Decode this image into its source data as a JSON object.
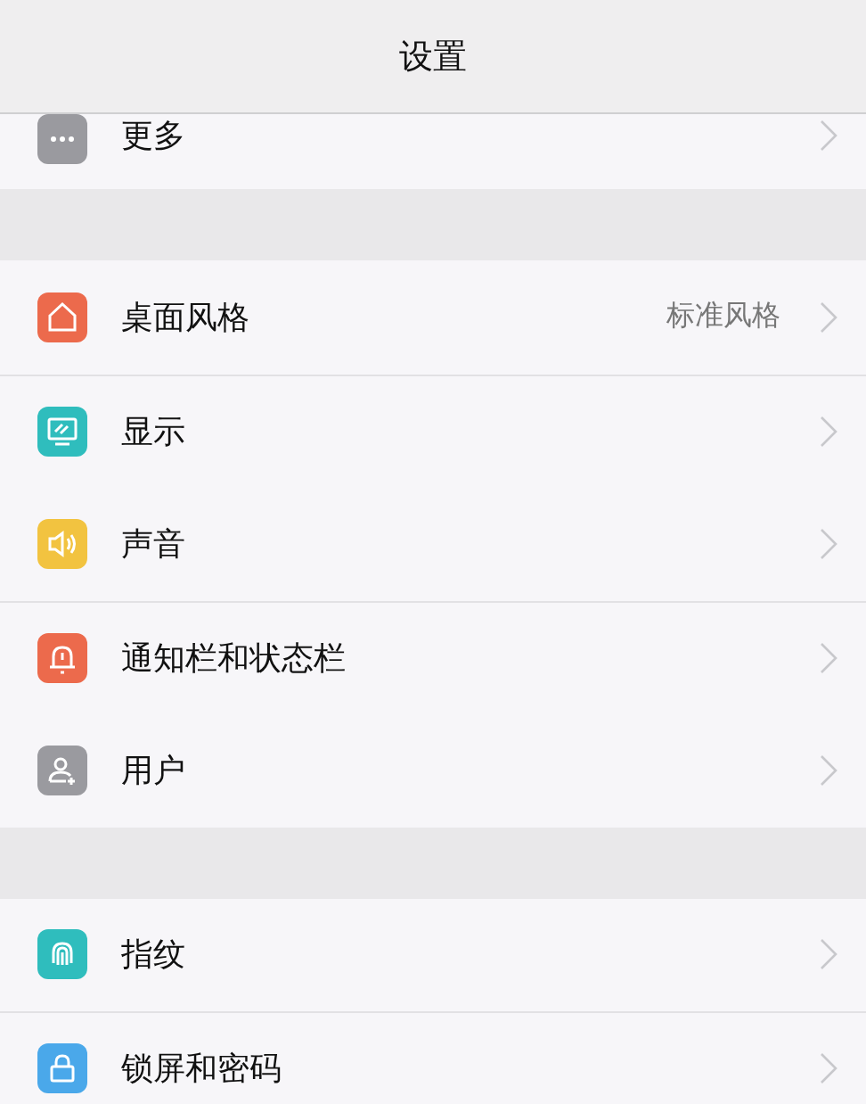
{
  "title": "设置",
  "groups": [
    {
      "items": [
        {
          "label": "更多",
          "kind": "more",
          "color": "#9a9a9f",
          "divider": false
        }
      ]
    },
    {
      "items": [
        {
          "label": "桌面风格",
          "value": "标准风格",
          "kind": "home",
          "color": "#ec6a4c",
          "divider": false
        },
        {
          "label": "显示",
          "kind": "display",
          "color": "#2fbdbd",
          "divider": true
        },
        {
          "label": "声音",
          "kind": "sound",
          "color": "#f2c340",
          "divider": false
        },
        {
          "label": "通知栏和状态栏",
          "kind": "bell",
          "color": "#ec6a4c",
          "divider": true
        },
        {
          "label": "用户",
          "kind": "user",
          "color": "#9a9a9f",
          "divider": false
        }
      ]
    },
    {
      "items": [
        {
          "label": "指纹",
          "kind": "fingerprint",
          "color": "#2fbdbd",
          "divider": false
        },
        {
          "label": "锁屏和密码",
          "kind": "lock",
          "color": "#4aa8ea",
          "divider": true
        }
      ]
    }
  ]
}
